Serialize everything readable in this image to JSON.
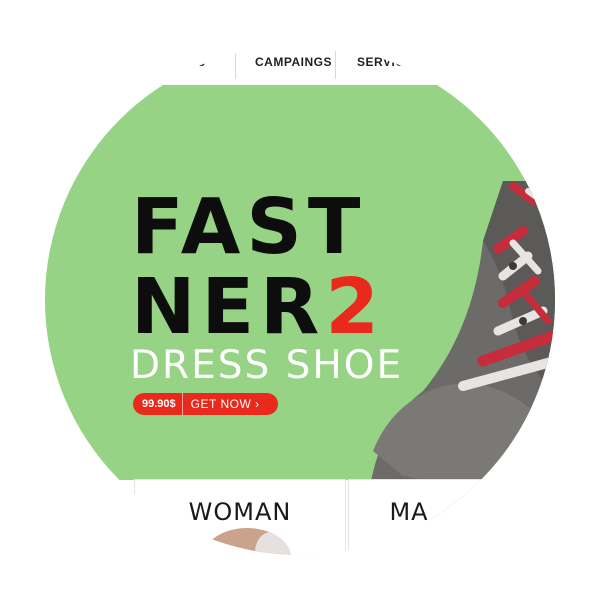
{
  "nav": {
    "items": [
      {
        "label": "S"
      },
      {
        "label": "CAMPAINGS"
      },
      {
        "label": "SERVICE"
      }
    ]
  },
  "hero": {
    "title_line1": "FAST",
    "title_line2": "NER",
    "title_number": "2",
    "subtitle": "DRESS SHOE",
    "price": "99.90$",
    "cta_label": "GET NOW ›"
  },
  "categories": [
    {
      "label": "WOMAN"
    },
    {
      "label": "MA"
    }
  ],
  "colors": {
    "hero_bg": "#96d385",
    "accent_red": "#e8291b",
    "title": "#0d0d0d"
  }
}
